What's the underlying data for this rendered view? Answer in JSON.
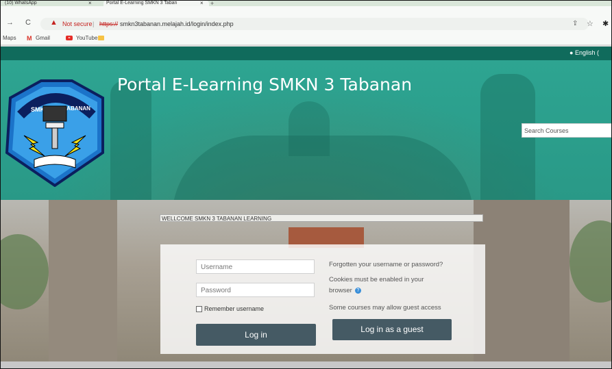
{
  "browser": {
    "tabs": [
      {
        "label": "(10) WhatsApp"
      },
      {
        "label": "Portal E-Learning SMKN 3 Taban"
      }
    ],
    "tab_close": "×",
    "new_tab": "+",
    "security_label": "Not secure",
    "url_scheme": "https://",
    "url_rest": "smkn3tabanan.melajah.id/login/index.php",
    "bookmarks": [
      {
        "label": "Maps"
      },
      {
        "label": "Gmail"
      },
      {
        "label": "YouTube"
      }
    ]
  },
  "header": {
    "language": "English (",
    "site_title": "Portal E-Learning SMKN 3 Tabanan",
    "search_placeholder": "Search Courses"
  },
  "main": {
    "welcome": "WELLCOME SMKN 3 TABANAN LEARNING",
    "username_placeholder": "Username",
    "password_placeholder": "Password",
    "remember_label": "Remember username",
    "login_button": "Log in",
    "forgot_link": "Forgotten your username or password?",
    "cookies_line1": "Cookies must be enabled in your",
    "cookies_line2": "browser",
    "guest_info": "Some courses may allow guest access",
    "guest_button": "Log in as a guest"
  },
  "logo": {
    "text": "SMKN 3 TABANAN"
  },
  "colors": {
    "topbar": "#106b5c",
    "hero": "#2aa894",
    "button": "#455a64"
  }
}
